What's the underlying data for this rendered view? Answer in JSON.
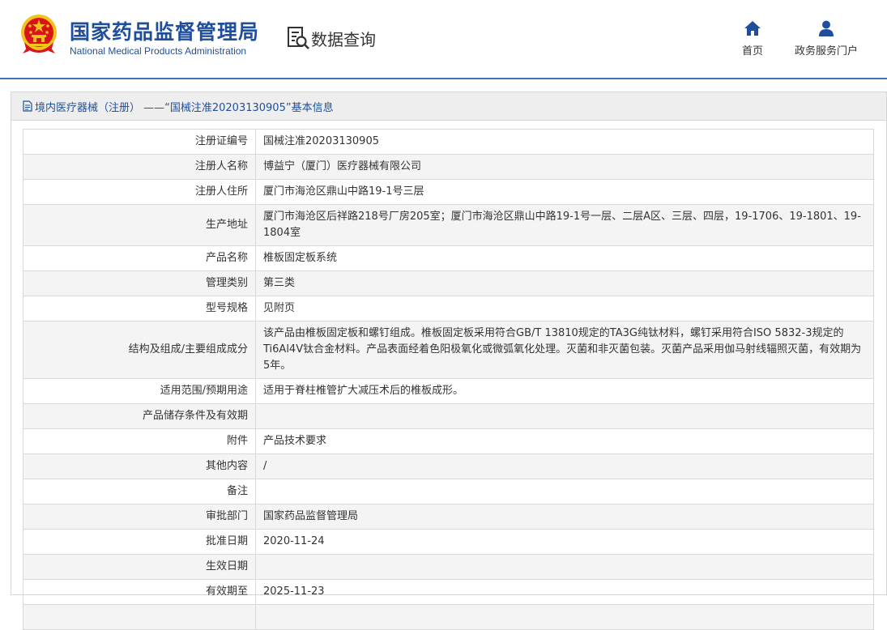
{
  "header": {
    "agency_cn": "国家药品监督管理局",
    "agency_en": "National Medical Products Administration",
    "section_title": "数据查询",
    "nav": [
      {
        "label": "首页",
        "icon": "home-icon"
      },
      {
        "label": "政务服务门户",
        "icon": "user-icon"
      }
    ]
  },
  "panel": {
    "title": "境内医疗器械（注册） ——“国械注准20203130905”基本信息"
  },
  "rows": [
    {
      "label": "注册证编号",
      "value": "国械注准20203130905"
    },
    {
      "label": "注册人名称",
      "value": "博益宁（厦门）医疗器械有限公司"
    },
    {
      "label": "注册人住所",
      "value": "厦门市海沧区鼎山中路19-1号三层"
    },
    {
      "label": "生产地址",
      "value": "厦门市海沧区后祥路218号厂房205室；厦门市海沧区鼎山中路19-1号一层、二层A区、三层、四层，19-1706、19-1801、19-1804室"
    },
    {
      "label": "产品名称",
      "value": "椎板固定板系统"
    },
    {
      "label": "管理类别",
      "value": "第三类"
    },
    {
      "label": "型号规格",
      "value": "见附页"
    },
    {
      "label": "结构及组成/主要组成成分",
      "value": "该产品由椎板固定板和螺钉组成。椎板固定板采用符合GB/T 13810规定的TA3G纯钛材料，螺钉采用符合ISO 5832-3规定的Ti6Al4V钛合金材料。产品表面经着色阳极氧化或微弧氧化处理。灭菌和非灭菌包装。灭菌产品采用伽马射线辐照灭菌，有效期为5年。"
    },
    {
      "label": "适用范围/预期用途",
      "value": "适用于脊柱椎管扩大减压术后的椎板成形。"
    },
    {
      "label": "产品储存条件及有效期",
      "value": ""
    },
    {
      "label": "附件",
      "value": "产品技术要求"
    },
    {
      "label": "其他内容",
      "value": "/"
    },
    {
      "label": "备注",
      "value": ""
    },
    {
      "label": "审批部门",
      "value": "国家药品监督管理局"
    },
    {
      "label": "批准日期",
      "value": "2020-11-24"
    },
    {
      "label": "生效日期",
      "value": ""
    },
    {
      "label": "有效期至",
      "value": "2025-11-23"
    },
    {
      "label": "",
      "value": ""
    }
  ],
  "colors": {
    "brand_blue": "#1f4f9b",
    "header_rule": "#3f73b4",
    "row_alt": "#f4f4f4",
    "emblem_red": "#d8141a",
    "emblem_gold": "#f3c21b"
  }
}
